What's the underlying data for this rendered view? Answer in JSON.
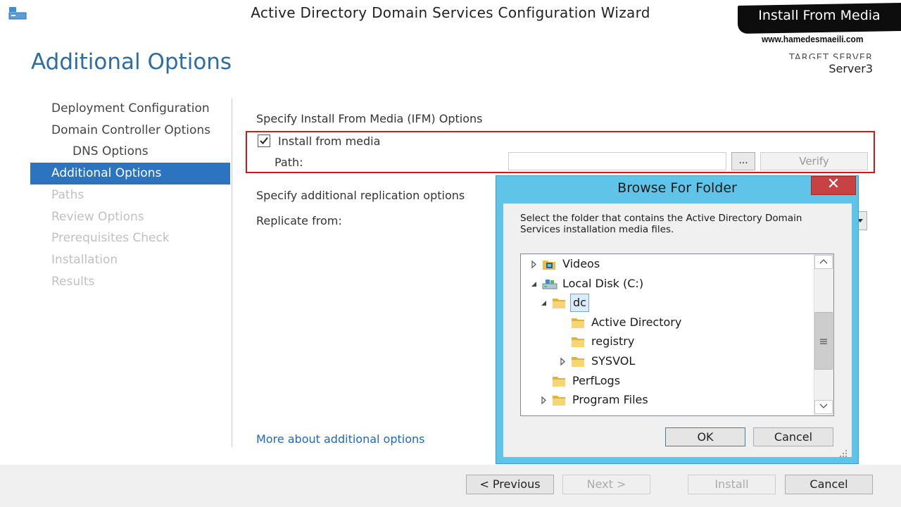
{
  "window": {
    "title": "Active Directory Domain Services Configuration Wizard",
    "target_label": "TARGET SERVER",
    "target_server": "Server3"
  },
  "watermark": {
    "banner": "Install From Media",
    "url": "www.hamedesmaeili.com"
  },
  "page": {
    "title": "Additional Options"
  },
  "nav": {
    "items": [
      {
        "label": "Deployment Configuration",
        "state": "normal"
      },
      {
        "label": "Domain Controller Options",
        "state": "normal"
      },
      {
        "label": "DNS Options",
        "state": "sub"
      },
      {
        "label": "Additional Options",
        "state": "active"
      },
      {
        "label": "Paths",
        "state": "disabled"
      },
      {
        "label": "Review Options",
        "state": "disabled"
      },
      {
        "label": "Prerequisites Check",
        "state": "disabled"
      },
      {
        "label": "Installation",
        "state": "disabled"
      },
      {
        "label": "Results",
        "state": "disabled"
      }
    ]
  },
  "content": {
    "ifm_heading": "Specify Install From Media (IFM) Options",
    "ifm_checkbox_label": "Install from media",
    "ifm_checked": true,
    "path_label": "Path:",
    "path_value": "",
    "browse_label": "...",
    "verify_label": "Verify",
    "replication_heading": "Specify additional replication options",
    "replicate_from_label": "Replicate from:",
    "more_link": "More about additional options"
  },
  "footer": {
    "previous": "< Previous",
    "next": "Next >",
    "install": "Install",
    "cancel": "Cancel"
  },
  "dialog": {
    "title": "Browse For Folder",
    "close": "✕",
    "instruction": "Select the folder that contains the Active Directory Domain Services installation media files.",
    "tree": [
      {
        "label": "Videos",
        "level": 0,
        "expander": "collapsed",
        "icon": "videos-folder-icon"
      },
      {
        "label": "Local Disk (C:)",
        "level": 0,
        "expander": "expanded",
        "icon": "local-disk-icon"
      },
      {
        "label": "dc",
        "level": 1,
        "expander": "expanded",
        "icon": "folder-icon",
        "selected": true
      },
      {
        "label": "Active Directory",
        "level": 2,
        "expander": "none",
        "icon": "folder-icon"
      },
      {
        "label": "registry",
        "level": 2,
        "expander": "none",
        "icon": "folder-icon"
      },
      {
        "label": "SYSVOL",
        "level": 2,
        "expander": "collapsed",
        "icon": "folder-icon"
      },
      {
        "label": "PerfLogs",
        "level": 1,
        "expander": "none",
        "icon": "folder-icon"
      },
      {
        "label": "Program Files",
        "level": 1,
        "expander": "collapsed",
        "icon": "folder-icon"
      }
    ],
    "ok": "OK",
    "cancel": "Cancel"
  }
}
